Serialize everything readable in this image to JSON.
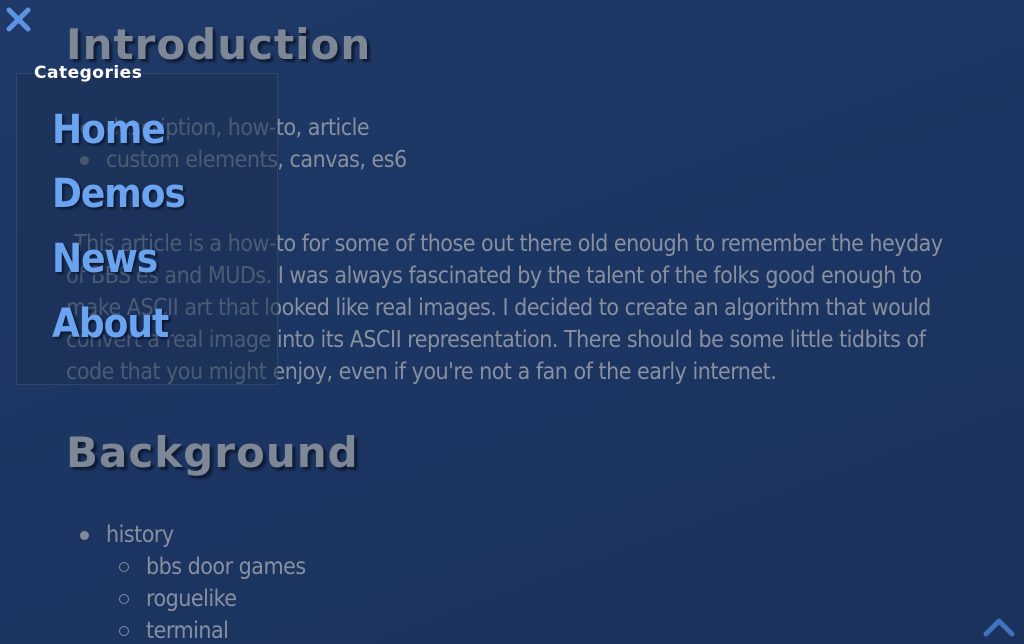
{
  "article": {
    "heading_intro": "Introduction",
    "tags": [
      "description, how-to, article",
      "custom elements, canvas, es6"
    ],
    "paragraph": "This article is a how-to for some of those out there old enough to remember the heyday of BBS'es and MUDs. I was always fascinated by the talent of the folks good enough to make ASCII art that looked like real images. I decided to create an algorithm that would convert a real image into its ASCII representation. There should be some little tidbits of code that you might enjoy, even if you're not a fan of the early internet.",
    "heading_background": "Background",
    "background_list": {
      "item": "history",
      "subitems": [
        "bbs door games",
        "roguelike",
        "terminal"
      ]
    }
  },
  "menu": {
    "title": "Categories",
    "items": [
      "Home",
      "Demos",
      "News",
      "About"
    ]
  },
  "icons": {
    "close": "close-icon",
    "scroll_top": "chevron-up-icon"
  },
  "colors": {
    "background": "#1c3562",
    "menu_link": "#6aa3f0",
    "text": "#8890a0"
  }
}
